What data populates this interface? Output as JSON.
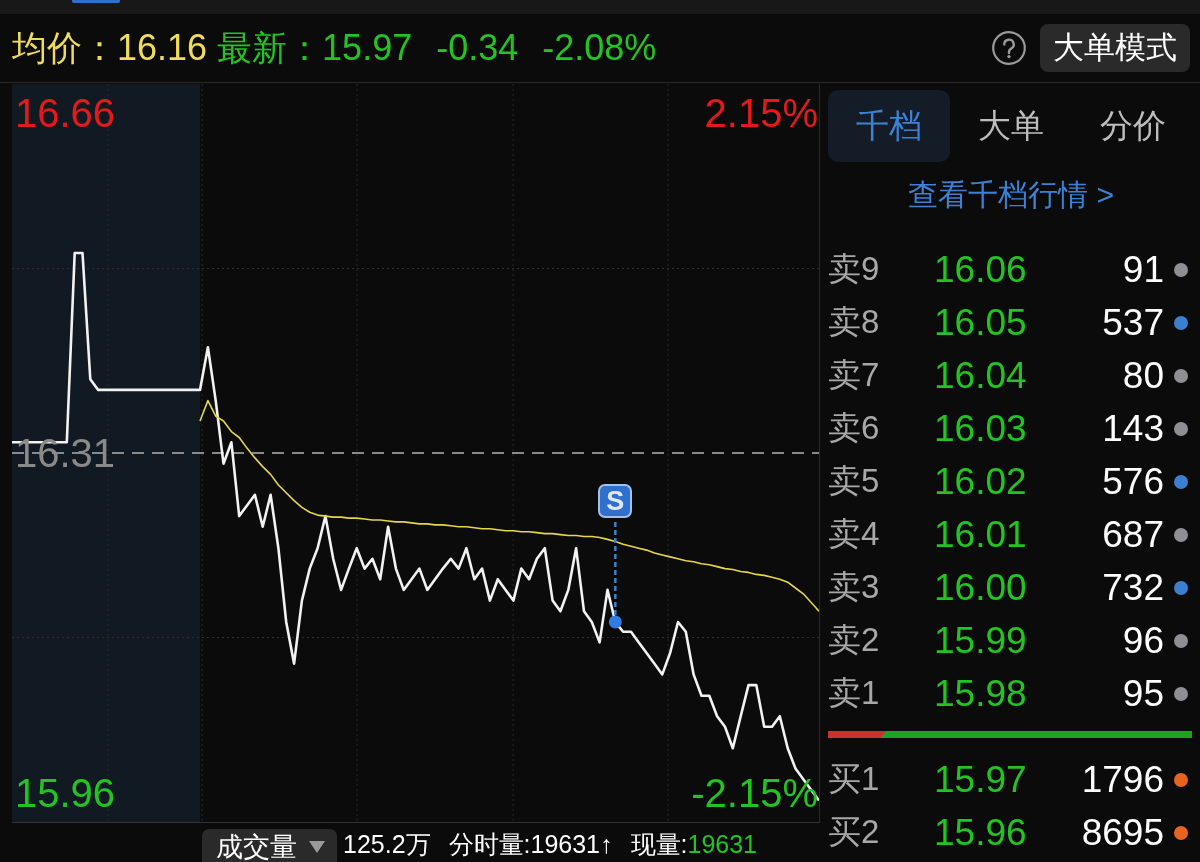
{
  "header": {
    "avg_label": "均价：",
    "avg_value": "16.16",
    "latest_label": "最新：",
    "latest_value": "15.97",
    "change": "-0.34",
    "change_percent": "-2.08%",
    "mode_button": "大单模式"
  },
  "chart": {
    "chart_data": [
      {
        "type": "line",
        "ylim": [
          15.93,
          16.69
        ],
        "y2lim": [
          -2.33,
          2.33
        ],
        "yticks": [
          {
            "value": 16.66,
            "label": "16.66"
          },
          {
            "value": 16.31,
            "label": "16.31"
          },
          {
            "value": 15.96,
            "label": "15.96"
          }
        ],
        "y2ticks": [
          {
            "value": 2.15,
            "label": "2.15%"
          },
          {
            "value": -2.15,
            "label": "-2.15%"
          }
        ],
        "ref_lines": [
          {
            "axis": "y",
            "value": 16.31,
            "color": "#8a8a8a",
            "line_style": "dashed"
          },
          {
            "axis": "y",
            "value": 16.5,
            "color": "#2e2e2e",
            "line_style": "dotted"
          },
          {
            "axis": "y",
            "value": 16.12,
            "color": "#2e2e2e",
            "line_style": "dotted"
          }
        ],
        "grid": true,
        "annotations": [
          "S"
        ],
        "series": [
          {
            "color": "#f2f2f2",
            "values": [
              16.321,
              16.321,
              16.321,
              16.321,
              16.321,
              16.321,
              16.321,
              16.321,
              16.516,
              16.516,
              16.386,
              16.375,
              16.375,
              16.375,
              16.375,
              16.375,
              16.375,
              16.375,
              16.375,
              16.375,
              16.375,
              16.375,
              16.375,
              16.375,
              16.375,
              16.419,
              16.364,
              16.299,
              16.321,
              16.245,
              16.256,
              16.267,
              16.234,
              16.267,
              16.212,
              16.136,
              16.093,
              16.158,
              16.191,
              16.212,
              16.245,
              16.201,
              16.169,
              16.191,
              16.212,
              16.191,
              16.201,
              16.18,
              16.234,
              16.191,
              16.169,
              16.18,
              16.191,
              16.169,
              16.18,
              16.191,
              16.201,
              16.191,
              16.212,
              16.18,
              16.191,
              16.158,
              16.18,
              16.169,
              16.158,
              16.191,
              16.18,
              16.201,
              16.212,
              16.158,
              16.147,
              16.169,
              16.212,
              16.147,
              16.136,
              16.115,
              16.169,
              16.136,
              16.126,
              16.126,
              16.115,
              16.104,
              16.093,
              16.082,
              16.104,
              16.136,
              16.126,
              16.082,
              16.06,
              16.06,
              16.039,
              16.028,
              16.006,
              16.039,
              16.071,
              16.071,
              16.028,
              16.028,
              16.039,
              16.006,
              15.985,
              15.974,
              15.963,
              15.952
            ]
          },
          {
            "color": "#e6d64a",
            "values": [
              null,
              null,
              null,
              null,
              null,
              null,
              null,
              null,
              null,
              null,
              null,
              null,
              null,
              null,
              null,
              null,
              null,
              null,
              null,
              null,
              null,
              null,
              null,
              null,
              16.343,
              16.364,
              16.348,
              16.343,
              16.332,
              16.326,
              16.315,
              16.305,
              16.296,
              16.288,
              16.277,
              16.269,
              16.261,
              16.254,
              16.249,
              16.246,
              16.245,
              16.244,
              16.244,
              16.243,
              16.243,
              16.242,
              16.241,
              16.241,
              16.24,
              16.239,
              16.239,
              16.238,
              16.237,
              16.237,
              16.236,
              16.236,
              16.235,
              16.234,
              16.234,
              16.233,
              16.232,
              16.232,
              16.231,
              16.23,
              16.23,
              16.229,
              16.229,
              16.228,
              16.227,
              16.227,
              16.226,
              16.225,
              16.225,
              16.224,
              16.224,
              16.223,
              16.221,
              16.219,
              16.216,
              16.214,
              16.212,
              16.21,
              16.207,
              16.205,
              16.203,
              16.201,
              16.199,
              16.198,
              16.196,
              16.195,
              16.193,
              16.191,
              16.19,
              16.188,
              16.187,
              16.185,
              16.184,
              16.182,
              16.18,
              16.177,
              16.171,
              16.165,
              16.156,
              16.147
            ]
          }
        ]
      }
    ],
    "volume_bar": {
      "selector": "成交量",
      "total": "125.2万",
      "tick_volume": "分时量:19631↑",
      "current_label": "现量:",
      "current_value": "19631"
    }
  },
  "order_book": {
    "tabs": [
      {
        "label": "千档",
        "selected": true
      },
      {
        "label": "大单",
        "selected": false
      },
      {
        "label": "分价",
        "selected": false
      }
    ],
    "link": "查看千档行情 >",
    "asks": [
      {
        "label": "卖9",
        "price": "16.06",
        "volume": "91",
        "color": "#8e8e93"
      },
      {
        "label": "卖8",
        "price": "16.05",
        "volume": "537",
        "color": "#3a7fd0"
      },
      {
        "label": "卖7",
        "price": "16.04",
        "volume": "80",
        "color": "#8e8e93"
      },
      {
        "label": "卖6",
        "price": "16.03",
        "volume": "143",
        "color": "#8e8e93"
      },
      {
        "label": "卖5",
        "price": "16.02",
        "volume": "576",
        "color": "#3a7fd0"
      },
      {
        "label": "卖4",
        "price": "16.01",
        "volume": "687",
        "color": "#8e8e93"
      },
      {
        "label": "卖3",
        "price": "16.00",
        "volume": "732",
        "color": "#3a7fd0"
      },
      {
        "label": "卖2",
        "price": "15.99",
        "volume": "96",
        "color": "#8e8e93"
      },
      {
        "label": "卖1",
        "price": "15.98",
        "volume": "95",
        "color": "#8e8e93"
      }
    ],
    "ratio_bar": {
      "level": 0.16
    },
    "bids": [
      {
        "label": "买1",
        "price": "15.97",
        "volume": "1796",
        "color": "#e8641e"
      },
      {
        "label": "买2",
        "price": "15.96",
        "volume": "8695",
        "color": "#e8641e"
      }
    ]
  }
}
